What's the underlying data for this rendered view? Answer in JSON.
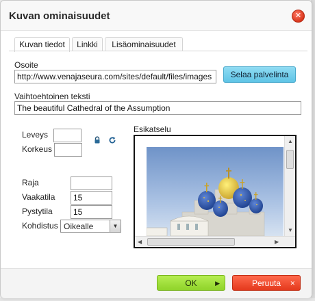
{
  "dialog": {
    "title": "Kuvan ominaisuudet",
    "close_icon": "close-icon"
  },
  "tabs": [
    {
      "label": "Kuvan tiedot",
      "active": true
    },
    {
      "label": "Linkki",
      "active": false
    },
    {
      "label": "Lisäominaisuudet",
      "active": false
    }
  ],
  "form": {
    "url_label": "Osoite",
    "url_value": "http://www.venajaseura.com/sites/default/files/images",
    "browse_label": "Selaa palvelinta",
    "alt_label": "Vaihtoehtoinen teksti",
    "alt_value": "The beautiful Cathedral of the Assumption",
    "width_label": "Leveys",
    "width_value": "",
    "height_label": "Korkeus",
    "height_value": "",
    "lock_icon": "lock-icon",
    "reset_icon": "reset-size-icon",
    "border_label": "Raja",
    "border_value": "",
    "hspace_label": "Vaakatila",
    "hspace_value": "15",
    "vspace_label": "Pystytila",
    "vspace_value": "15",
    "align_label": "Kohdistus",
    "align_value": "Oikealle"
  },
  "preview": {
    "label": "Esikatselu",
    "image_alt": "The beautiful Cathedral of the Assumption"
  },
  "footer": {
    "ok_label": "OK",
    "cancel_label": "Peruuta"
  },
  "colors": {
    "ok_button": "#8fd32a",
    "cancel_button": "#e4391c",
    "browse_button": "#5fc4e6",
    "close_button": "#d9361c"
  }
}
